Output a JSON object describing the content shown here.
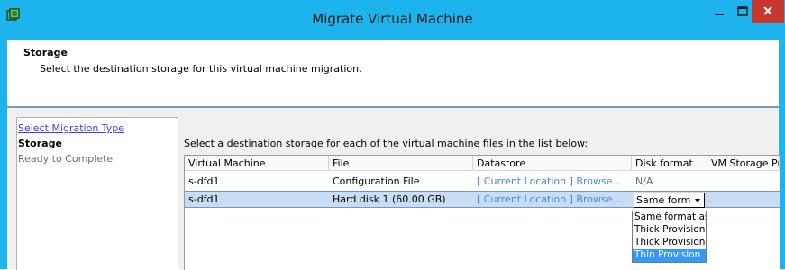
{
  "window": {
    "title": "Migrate Virtual Machine",
    "accent_color": "#1db4ed",
    "close_color": "#c7372c",
    "app_icon": "vsphere-app-icon",
    "minimize_icon": "minimize-icon",
    "maximize_icon": "maximize-icon",
    "close_icon": "close-icon"
  },
  "header": {
    "title": "Storage",
    "description": "Select the destination storage for this virtual machine migration."
  },
  "nav": {
    "items": [
      {
        "label": "Select Migration Type",
        "state": "link"
      },
      {
        "label": "Storage",
        "state": "current"
      },
      {
        "label": "Ready to Complete",
        "state": "disabled"
      }
    ]
  },
  "main": {
    "instruction": "Select a destination storage for each of the virtual machine files in the list below:",
    "columns": [
      "Virtual Machine",
      "File",
      "Datastore",
      "Disk format",
      "VM Storage Pro"
    ],
    "rows": [
      {
        "vm": "s-dfd1",
        "file": "Configuration File",
        "datastore": "[ Current Location ] Browse...",
        "disk_format": "N/A",
        "selected": false
      },
      {
        "vm": "s-dfd1",
        "file": "Hard disk 1 (60.00 GB)",
        "datastore": "[ Current Location ] Browse...",
        "disk_format": "Same forma",
        "selected": true
      }
    ],
    "dropdown": {
      "options": [
        "Same format as",
        "Thick Provision",
        "Thick Provision",
        "Thin Provision"
      ],
      "highlighted_index": 3,
      "highlight_color": "#3399ff"
    },
    "combo_arrow_icon": "chevron-down-icon"
  }
}
